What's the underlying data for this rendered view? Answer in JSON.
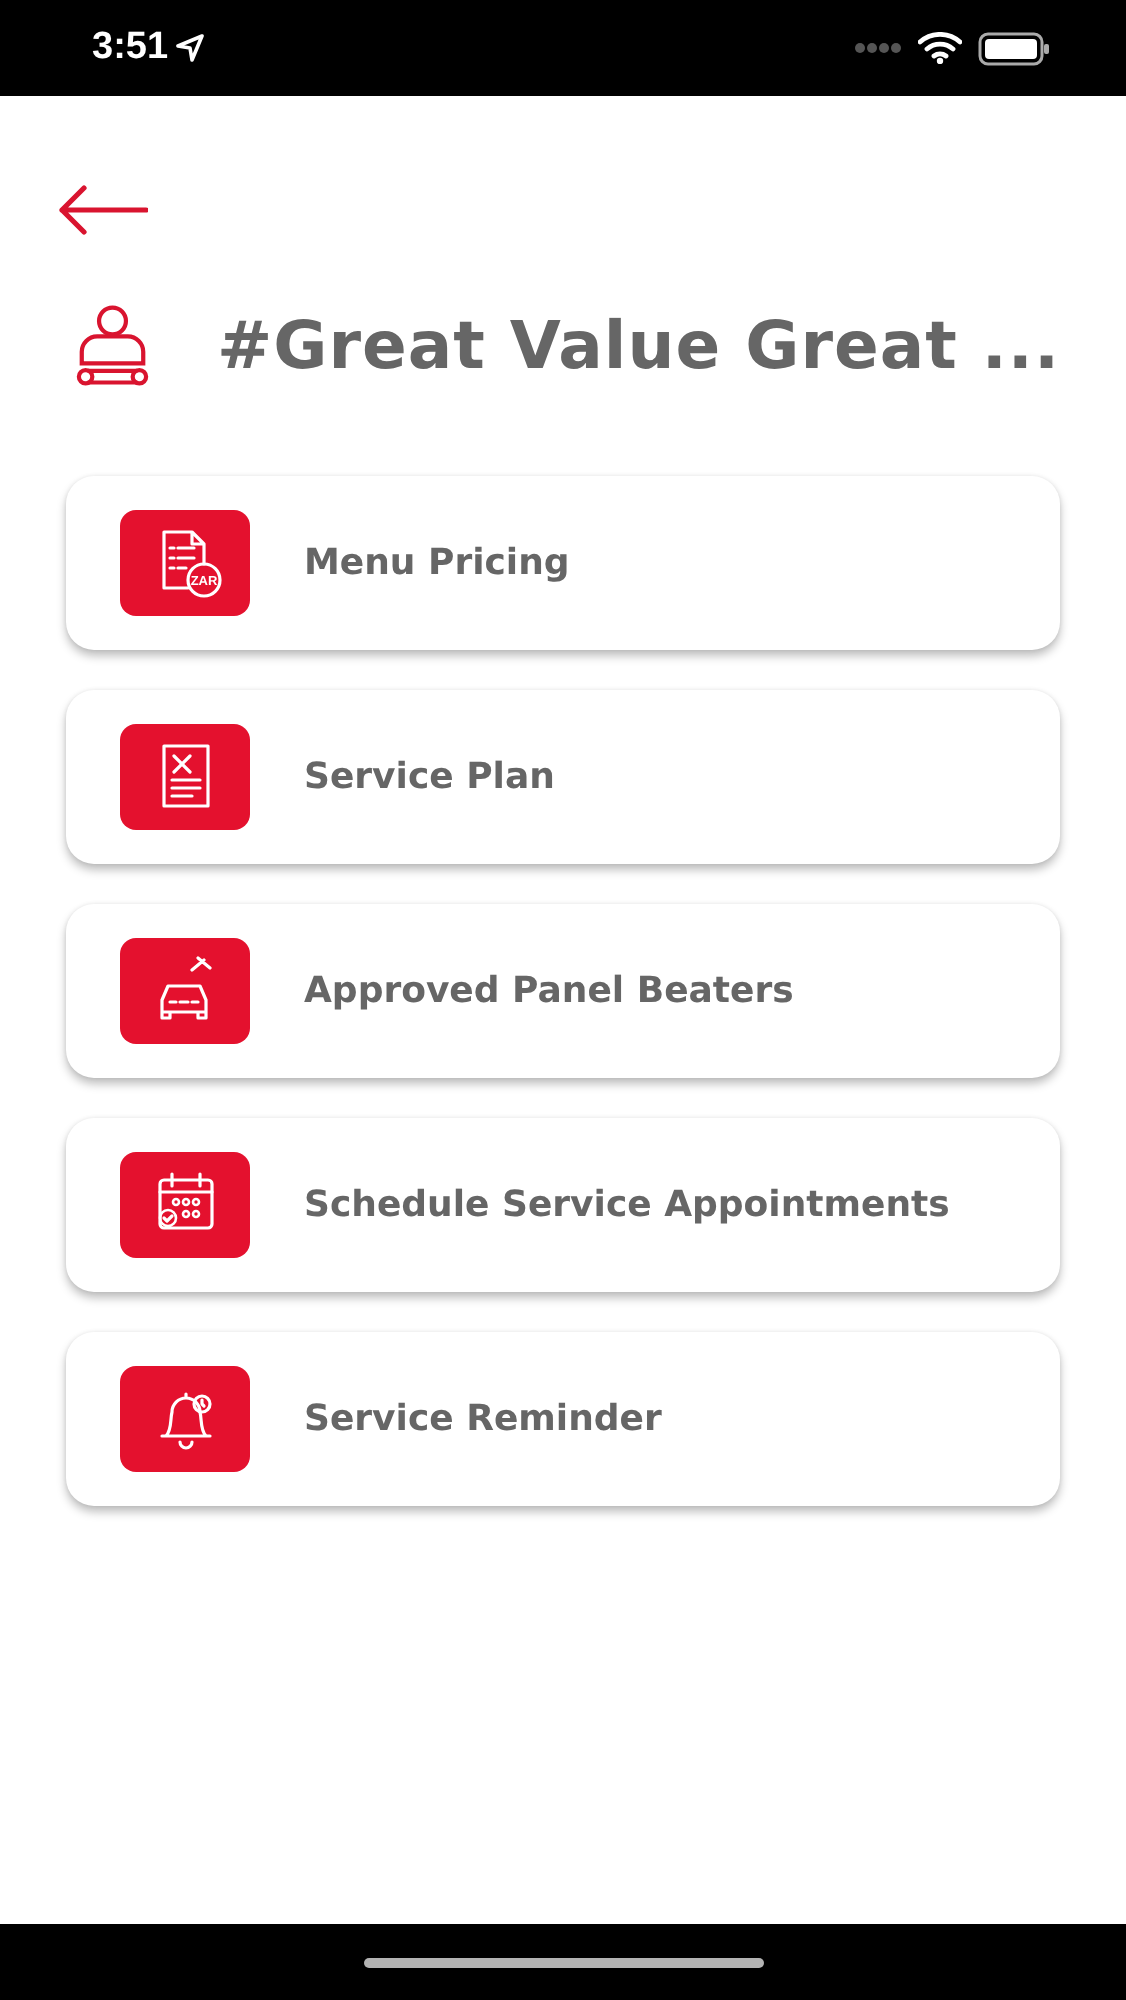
{
  "status_bar": {
    "time": "3:51"
  },
  "header": {
    "title": "#Great Value Great ..."
  },
  "menu_items": [
    {
      "label": "Menu Pricing",
      "kind": "pricing",
      "icon_text": "ZAR"
    },
    {
      "label": "Service Plan",
      "kind": "plan"
    },
    {
      "label": "Approved Panel Beaters",
      "kind": "repair"
    },
    {
      "label": "Schedule Service Appointments",
      "kind": "schedule"
    },
    {
      "label": "Service Reminder",
      "kind": "reminder"
    }
  ]
}
